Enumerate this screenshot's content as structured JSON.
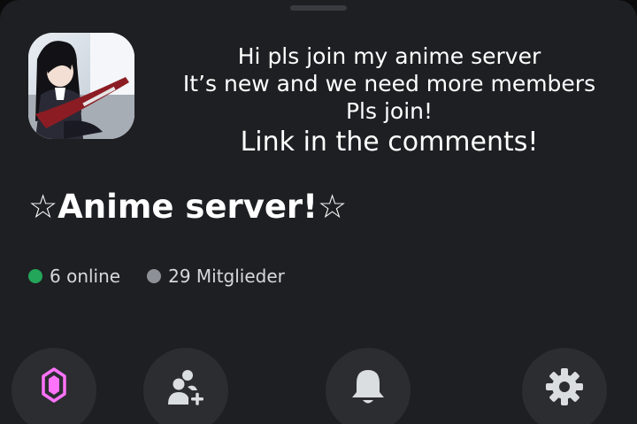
{
  "overlay_text": {
    "line1": "Hi pls join my anime server",
    "line2": "It’s new and we need more members",
    "line3": "Pls join!",
    "line4": "Link in the comments!"
  },
  "server": {
    "name": "☆Anime server!☆",
    "online_count_label": "6 online",
    "member_count_label": "29 Mitglieder"
  },
  "status_colors": {
    "online": "#23a55a",
    "members": "#8e9098"
  },
  "actions": [
    {
      "icon": "nitro-boost-icon"
    },
    {
      "icon": "invite-members-icon"
    },
    {
      "icon": "notification-bell-icon"
    },
    {
      "icon": "settings-gear-icon"
    }
  ]
}
